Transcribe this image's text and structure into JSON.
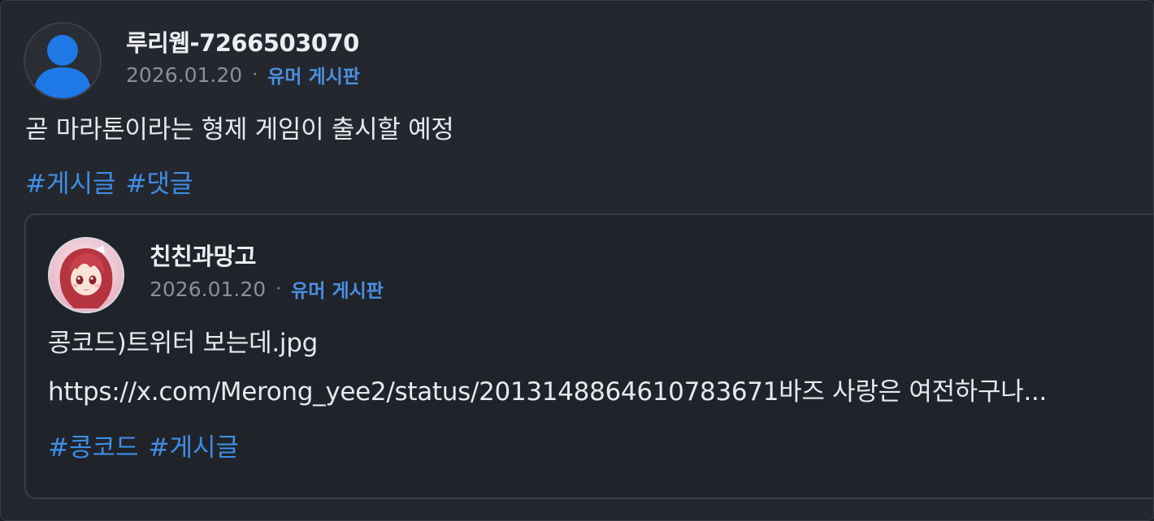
{
  "post": {
    "author": "루리웹-7266503070",
    "date": "2026.01.20",
    "separator": "·",
    "board": "유머 게시판",
    "text": "곧 마라톤이라는 형제 게임이 출시할 예정",
    "tags": [
      "#게시글",
      "#댓글"
    ]
  },
  "quoted": {
    "author": "친친과망고",
    "date": "2026.01.20",
    "separator": "·",
    "board": "유머 게시판",
    "title": "콩코드)트위터 보는데.jpg",
    "text": "https://x.com/Merong_yee2/status/2013148864610783671바즈 사랑은 여전하구나...",
    "tags": [
      "#콩코드",
      "#게시글"
    ]
  },
  "icons": {
    "main_avatar": "default-user-avatar-icon",
    "quoted_avatar": "anime-character-avatar"
  },
  "colors": {
    "background": "#24272e",
    "accent": "#3f8ee6",
    "avatar_blue": "#1e78e6"
  }
}
